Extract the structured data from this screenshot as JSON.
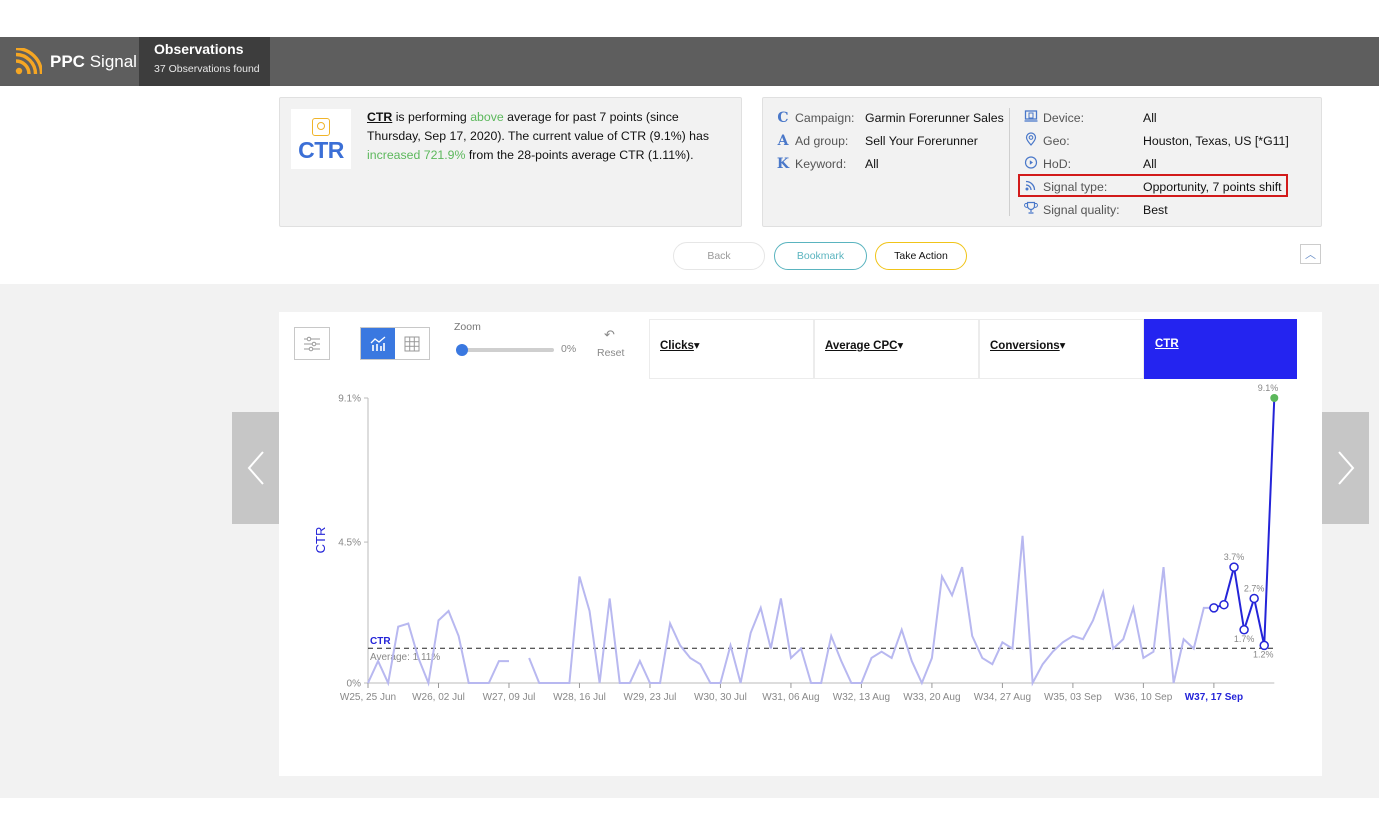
{
  "header": {
    "brand_bold": "PPC",
    "brand_rest": "Signal",
    "tab_title": "Observations",
    "tab_subtitle": "37 Observations found"
  },
  "summary": {
    "logo_label": "CTR",
    "metric": "CTR",
    "text_1": " is performing ",
    "direction": "above",
    "text_2": " average for past 7 points (since Thursday, Sep 17, 2020). The current value of CTR (9.1%) has ",
    "change": "increased 721.9%",
    "text_3": " from the 28-points average CTR (1.11%)."
  },
  "details": {
    "left": [
      {
        "icon": "C",
        "label": "Campaign:",
        "value": "Garmin Forerunner Sales"
      },
      {
        "icon": "A",
        "label": "Ad group:",
        "value": "Sell Your Forerunner"
      },
      {
        "icon": "K",
        "label": "Keyword:",
        "value": "All"
      }
    ],
    "right": [
      {
        "icon": "device-icon",
        "label": "Device:",
        "value": "All"
      },
      {
        "icon": "location-pin-icon",
        "label": "Geo:",
        "value": "Houston, Texas, US [*G11]"
      },
      {
        "icon": "clock-play-icon",
        "label": "HoD:",
        "value": "All"
      },
      {
        "icon": "rss-signal-icon",
        "label": "Signal type:",
        "value": "Opportunity, 7 points shift"
      },
      {
        "icon": "trophy-icon",
        "label": "Signal quality:",
        "value": "Best"
      }
    ]
  },
  "actions": {
    "back": "Back",
    "bookmark": "Bookmark",
    "take_action": "Take Action"
  },
  "toolbar": {
    "zoom_label": "Zoom",
    "zoom_value": "0%",
    "zoom_fraction": 0,
    "reset_label": "Reset"
  },
  "metric_tabs": [
    {
      "label": "Clicks",
      "arrow": "▾",
      "active": false
    },
    {
      "label": "Average CPC",
      "arrow": "▾",
      "active": false
    },
    {
      "label": "Conversions",
      "arrow": "▾",
      "active": false
    },
    {
      "label": "CTR",
      "arrow": "",
      "active": true
    }
  ],
  "colors": {
    "accent": "#2424f0",
    "history_line": "#b8b8f0",
    "signal_line": "#2424d8",
    "positive": "#5cb85c",
    "highlight_box": "#d21a1a",
    "brand_orange": "#f5a623"
  },
  "chart_data": {
    "type": "line",
    "ylabel": "CTR",
    "yticks": [
      "0%",
      "4.5%",
      "9.1%"
    ],
    "ylim": [
      0,
      9.1
    ],
    "xticks": [
      "W25, 25 Jun",
      "W26, 02 Jul",
      "W27, 09 Jul",
      "W28, 16 Jul",
      "W29, 23 Jul",
      "W30, 30 Jul",
      "W31, 06 Aug",
      "W32, 13 Aug",
      "W33, 20 Aug",
      "W34, 27 Aug",
      "W35, 03 Sep",
      "W36, 10 Sep",
      "W37, 17 Sep"
    ],
    "highlight_xtick": "W37, 17 Sep",
    "average": {
      "label": "CTR",
      "text": "Average: 1.11%",
      "value": 1.11
    },
    "history": [
      0,
      0.7,
      0,
      1.8,
      1.9,
      0.8,
      0,
      2.0,
      2.3,
      1.5,
      0,
      0,
      0,
      0.7,
      0.7,
      null,
      0.8,
      0,
      0,
      0,
      0,
      3.4,
      2.3,
      0,
      2.7,
      0,
      0,
      0.7,
      0,
      0,
      1.9,
      1.2,
      0.8,
      0.6,
      0,
      0,
      1.2,
      0,
      1.6,
      2.4,
      1.1,
      2.7,
      0.8,
      1.1,
      0,
      0,
      1.5,
      0.7,
      0,
      0,
      0.8,
      1.0,
      0.8,
      1.7,
      0.7,
      0,
      0.8,
      3.4,
      2.8,
      3.7,
      1.5,
      0.8,
      0.6,
      1.3,
      1.1,
      4.7,
      0,
      0.6,
      1.0,
      1.3,
      1.5,
      1.4,
      2.0,
      2.9,
      1.1,
      1.4,
      2.4,
      0.8,
      1.0,
      3.7,
      0,
      1.4,
      1.1,
      2.4
    ],
    "signal": [
      2.4,
      2.5,
      3.7,
      1.7,
      2.7,
      1.2,
      9.1
    ],
    "signal_labels": [
      "",
      "",
      "3.7%",
      "1.7%",
      "2.7%",
      "1.2%",
      "9.1%"
    ]
  }
}
